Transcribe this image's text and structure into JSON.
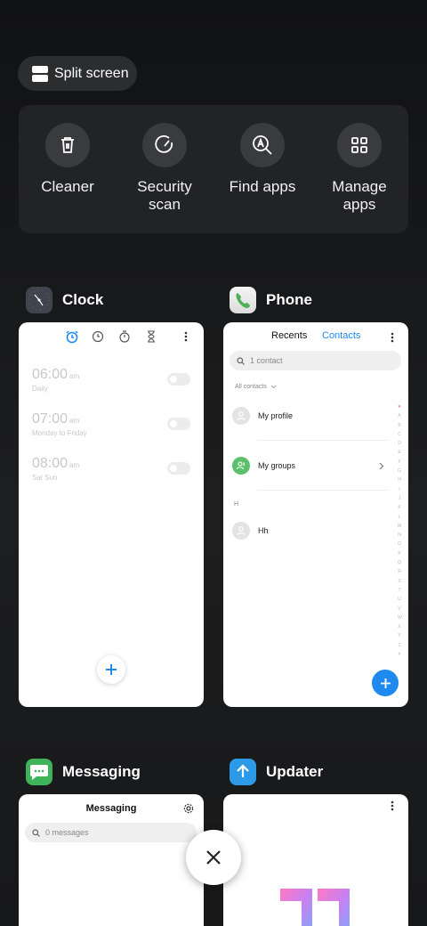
{
  "split_screen": {
    "label": "Split screen",
    "icon": "split-screen-icon"
  },
  "quick_tools": [
    {
      "label": "Cleaner",
      "icon": "trash-icon"
    },
    {
      "label": "Security\nscan",
      "icon": "security-scan-icon"
    },
    {
      "label": "Find apps",
      "icon": "find-apps-icon"
    },
    {
      "label": "Manage\napps",
      "icon": "grid-icon"
    }
  ],
  "apps": {
    "clock": {
      "name": "Clock",
      "alarms": [
        {
          "time": "06:00",
          "ampm": "am",
          "repeat": "Daily"
        },
        {
          "time": "07:00",
          "ampm": "am",
          "repeat": "Monday to Friday"
        },
        {
          "time": "08:00",
          "ampm": "am",
          "repeat": "Sat Sun"
        }
      ]
    },
    "phone": {
      "name": "Phone",
      "tabs": [
        "Recents",
        "Contacts"
      ],
      "search_placeholder": "1 contact",
      "filter": "All contacts",
      "contacts": [
        {
          "name": "My profile"
        },
        {
          "name": "My groups"
        }
      ],
      "section_letter": "H",
      "section_contacts": [
        {
          "name": "Hh"
        }
      ],
      "alphabet": [
        "♥",
        "A",
        "B",
        "C",
        "D",
        "E",
        "F",
        "G",
        "H",
        "I",
        "J",
        "K",
        "L",
        "M",
        "N",
        "O",
        "P",
        "Q",
        "R",
        "S",
        "T",
        "U",
        "V",
        "W",
        "X",
        "Y",
        "Z",
        "#"
      ]
    },
    "messaging": {
      "name": "Messaging",
      "title": "Messaging",
      "search_placeholder": "0 messages"
    },
    "updater": {
      "name": "Updater"
    }
  },
  "colors": {
    "accent": "#1e8af0",
    "background": "#141516",
    "card": "#ffffff"
  }
}
